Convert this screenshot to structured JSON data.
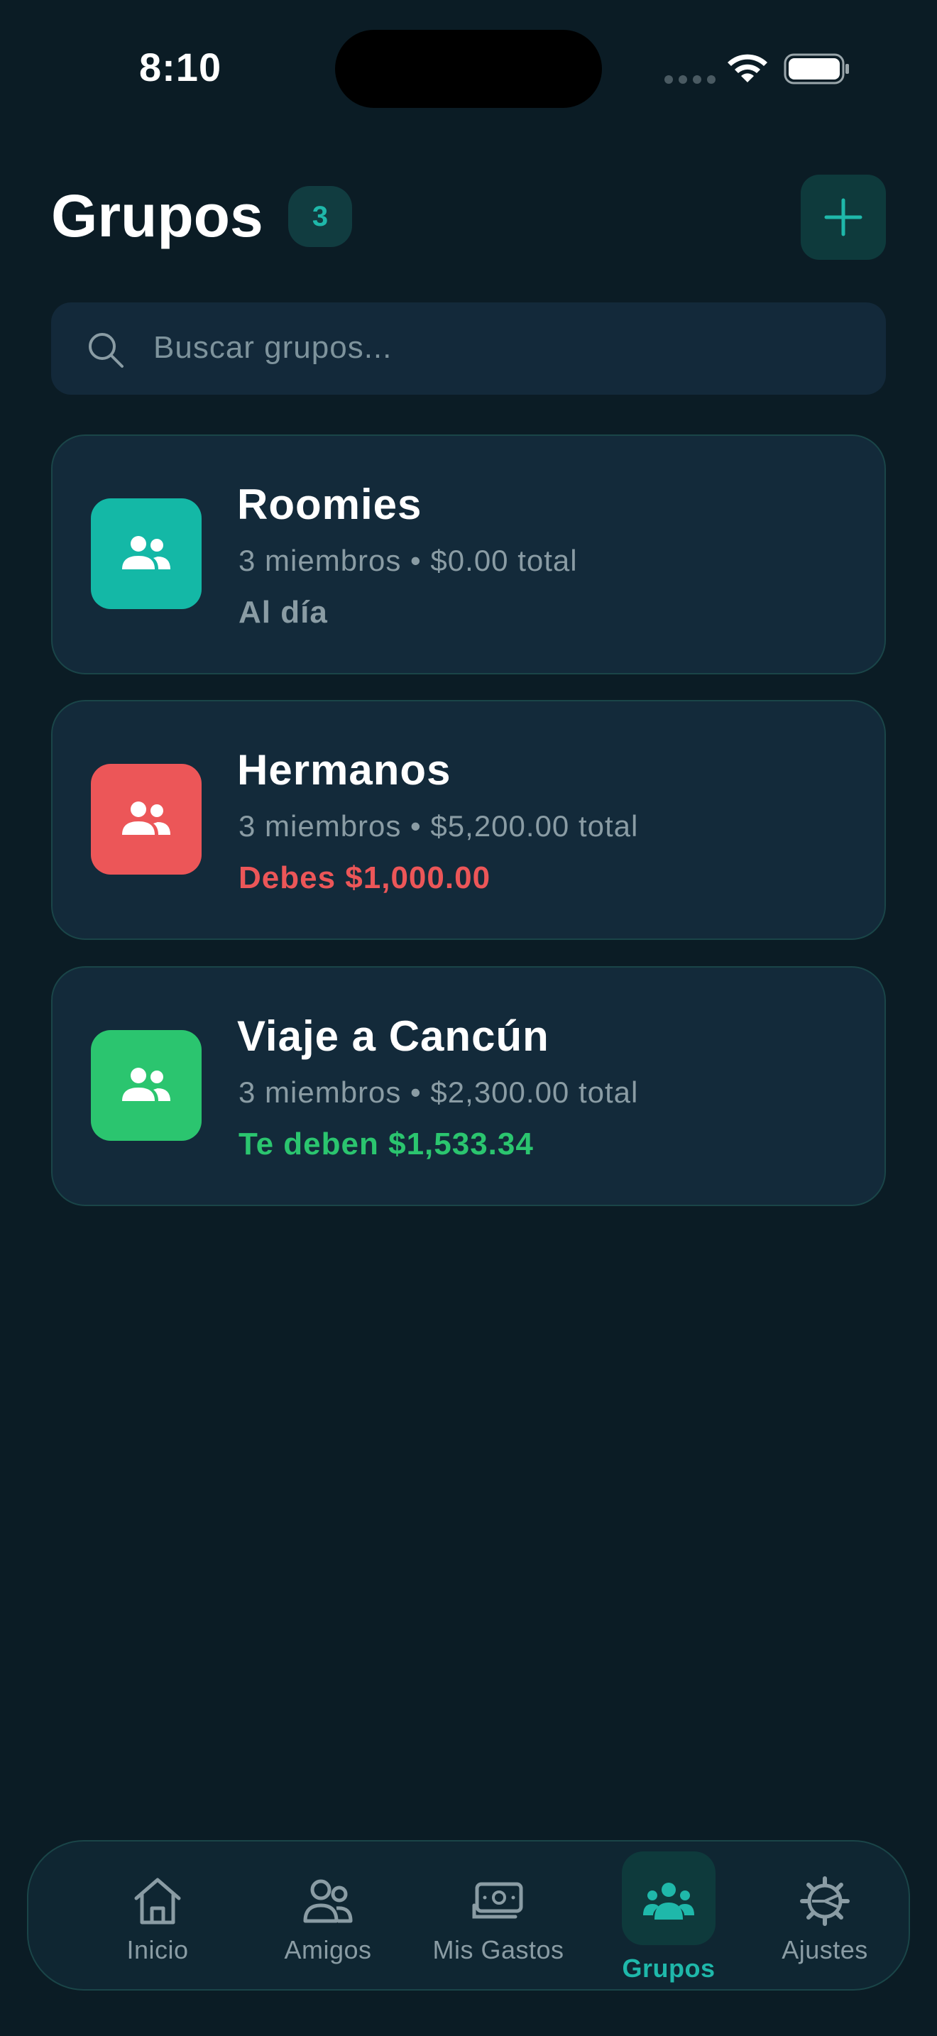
{
  "status_bar": {
    "time": "8:10"
  },
  "header": {
    "title": "Grupos",
    "count": "3"
  },
  "search": {
    "placeholder": "Buscar grupos..."
  },
  "groups": [
    {
      "name": "Roomies",
      "meta": "3 miembros • $0.00 total",
      "status": "Al día",
      "status_color": "#8a9ca4",
      "avatar_color": "#14b8a6"
    },
    {
      "name": "Hermanos",
      "meta": "3 miembros • $5,200.00 total",
      "status": "Debes $1,000.00",
      "status_color": "#ec5658",
      "avatar_color": "#ec5658"
    },
    {
      "name": "Viaje a Cancún",
      "meta": "3 miembros • $2,300.00 total",
      "status": "Te deben $1,533.34",
      "status_color": "#2bc56f",
      "avatar_color": "#2bc56f"
    }
  ],
  "tabs": [
    {
      "label": "Inicio",
      "icon": "home-icon"
    },
    {
      "label": "Amigos",
      "icon": "friends-icon"
    },
    {
      "label": "Mis Gastos",
      "icon": "money-icon"
    },
    {
      "label": "Grupos",
      "icon": "groups-icon",
      "active": true
    },
    {
      "label": "Ajustes",
      "icon": "settings-icon"
    }
  ],
  "colors": {
    "accent": "#1fb8aa",
    "background": "#0b1c25",
    "card": "#132a3a"
  }
}
